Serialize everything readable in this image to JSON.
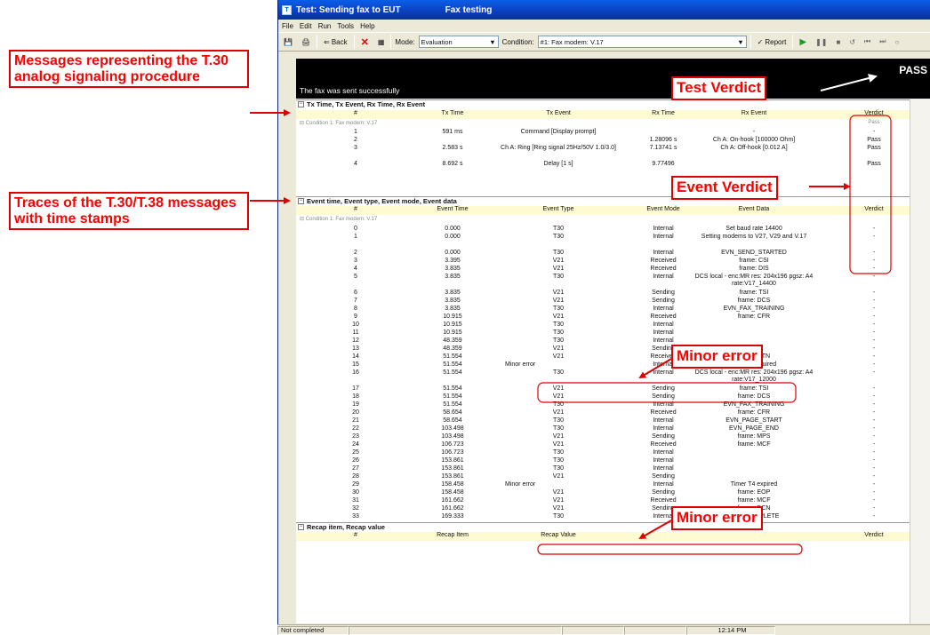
{
  "window": {
    "title": "Test: Sending fax to EUT",
    "subtitle": "Fax testing"
  },
  "menu": [
    "File",
    "Edit",
    "Run",
    "Tools",
    "Help"
  ],
  "toolbar": {
    "back_label": "Back",
    "mode_label": "Mode:",
    "mode_value": "Evaluation",
    "condition_label": "Condition:",
    "condition_value": "#1: Fax modem: V.17",
    "report_label": "Report"
  },
  "banner": {
    "verdict": "PASS",
    "message": "The fax was sent successfully"
  },
  "section1": {
    "title": "Tx Time, Tx Event, Rx Time, Rx Event",
    "headers": [
      "#",
      "Tx Time",
      "Tx Event",
      "Rx Time",
      "Rx Event",
      "Verdict"
    ],
    "condition": "Condition 1: Fax modem: V.17",
    "condition_verdict": "Pass",
    "rows": [
      {
        "n": "1",
        "txt": "591 ms",
        "txe": "Command [Display prompt]",
        "rxt": "",
        "rxe": "-",
        "v": "-"
      },
      {
        "n": "2",
        "txt": "",
        "txe": "",
        "rxt": "1.28096 s",
        "rxe": "Ch A: On-hook [100000 Ohm]",
        "v": "Pass"
      },
      {
        "n": "3",
        "txt": "2.583 s",
        "txe": "Ch A: Ring [Ring signal 25Hz/50V 1.0/3.0]",
        "rxt": "7.13741 s",
        "rxe": "Ch A: Off-hook [0.012 A]",
        "v": "Pass"
      },
      {
        "n": "4",
        "txt": "8.692 s",
        "txe": "Delay [1 s]",
        "rxt": "9.77496",
        "rxe": "",
        "v": "Pass"
      }
    ]
  },
  "section2": {
    "title": "Event time, Event type, Event mode, Event data",
    "headers": [
      "#",
      "Event Time",
      "Event Type",
      "Event Mode",
      "Event Data",
      "Verdict"
    ],
    "condition": "Condition 1: Fax modem: V.17",
    "rows": [
      {
        "n": "0",
        "t": "0.000",
        "ty": "T30",
        "m": "Internal",
        "d": "Set baud rate 14400",
        "v": "-"
      },
      {
        "n": "1",
        "t": "0.000",
        "ty": "T30",
        "m": "Internal",
        "d": "Setting modems to V27, V29 and V.17",
        "v": "-"
      },
      {
        "n": "2",
        "t": "0.000",
        "ty": "T30",
        "m": "Internal",
        "d": "EVN_SEND_STARTED",
        "v": "-"
      },
      {
        "n": "3",
        "t": "3.395",
        "ty": "V21",
        "m": "Received",
        "d": "frame: CSI",
        "v": "-"
      },
      {
        "n": "4",
        "t": "3.835",
        "ty": "V21",
        "m": "Received",
        "d": "frame: DIS",
        "v": "-"
      },
      {
        "n": "5",
        "t": "3.835",
        "ty": "T30",
        "m": "Internal",
        "d": "DCS local - enc:MR res: 204x196 pgsz: A4 rate:V17_14400",
        "v": "-"
      },
      {
        "n": "6",
        "t": "3.835",
        "ty": "V21",
        "m": "Sending",
        "d": "frame: TSI",
        "v": "-"
      },
      {
        "n": "7",
        "t": "3.835",
        "ty": "V21",
        "m": "Sending",
        "d": "frame: DCS",
        "v": "-"
      },
      {
        "n": "8",
        "t": "3.835",
        "ty": "T30",
        "m": "Internal",
        "d": "EVN_FAX_TRAINING",
        "v": "-"
      },
      {
        "n": "9",
        "t": "10.915",
        "ty": "V21",
        "m": "Received",
        "d": "frame: CFR",
        "v": "-"
      },
      {
        "n": "10",
        "t": "10.915",
        "ty": "T30",
        "m": "Internal",
        "d": "",
        "v": "-"
      },
      {
        "n": "11",
        "t": "10.915",
        "ty": "T30",
        "m": "Internal",
        "d": "",
        "v": "-"
      },
      {
        "n": "12",
        "t": "48.359",
        "ty": "T30",
        "m": "Internal",
        "d": "",
        "v": "-"
      },
      {
        "n": "13",
        "t": "48.359",
        "ty": "V21",
        "m": "Sending",
        "d": "",
        "v": "-"
      },
      {
        "n": "14",
        "t": "51.554",
        "ty": "V21",
        "m": "Received",
        "d": "frame: RTN",
        "v": "-"
      },
      {
        "n": "15",
        "t": "51.554",
        "ty": "Minor error",
        "m": "Internal",
        "d": "Retrain required",
        "v": "-"
      },
      {
        "n": "16",
        "t": "51.554",
        "ty": "T30",
        "m": "Internal",
        "d": "DCS local - enc:MR res: 204x196 pgsz: A4 rate:V17_12000",
        "v": "-"
      },
      {
        "n": "17",
        "t": "51.554",
        "ty": "V21",
        "m": "Sending",
        "d": "frame: TSI",
        "v": "-"
      },
      {
        "n": "18",
        "t": "51.554",
        "ty": "V21",
        "m": "Sending",
        "d": "frame: DCS",
        "v": "-"
      },
      {
        "n": "19",
        "t": "51.554",
        "ty": "T30",
        "m": "Internal",
        "d": "EVN_FAX_TRAINING",
        "v": "-"
      },
      {
        "n": "20",
        "t": "58.654",
        "ty": "V21",
        "m": "Received",
        "d": "frame: CFR",
        "v": "-"
      },
      {
        "n": "21",
        "t": "58.654",
        "ty": "T30",
        "m": "Internal",
        "d": "EVN_PAGE_START",
        "v": "-"
      },
      {
        "n": "22",
        "t": "103.498",
        "ty": "T30",
        "m": "Internal",
        "d": "EVN_PAGE_END",
        "v": "-"
      },
      {
        "n": "23",
        "t": "103.498",
        "ty": "V21",
        "m": "Sending",
        "d": "frame: MPS",
        "v": "-"
      },
      {
        "n": "24",
        "t": "106.723",
        "ty": "V21",
        "m": "Received",
        "d": "frame: MCF",
        "v": "-"
      },
      {
        "n": "25",
        "t": "106.723",
        "ty": "T30",
        "m": "Internal",
        "d": "",
        "v": "-"
      },
      {
        "n": "26",
        "t": "153.861",
        "ty": "T30",
        "m": "Internal",
        "d": "",
        "v": "-"
      },
      {
        "n": "27",
        "t": "153.861",
        "ty": "T30",
        "m": "Internal",
        "d": "",
        "v": "-"
      },
      {
        "n": "28",
        "t": "153.861",
        "ty": "V21",
        "m": "Sending",
        "d": "",
        "v": "-"
      },
      {
        "n": "29",
        "t": "158.458",
        "ty": "Minor error",
        "m": "Internal",
        "d": "Timer T4 expired",
        "v": "-"
      },
      {
        "n": "30",
        "t": "158.458",
        "ty": "V21",
        "m": "Sending",
        "d": "frame: EOP",
        "v": "-"
      },
      {
        "n": "31",
        "t": "161.662",
        "ty": "V21",
        "m": "Received",
        "d": "frame: MCF",
        "v": "-"
      },
      {
        "n": "32",
        "t": "161.662",
        "ty": "V21",
        "m": "Sending",
        "d": "frame: DCN",
        "v": "-"
      },
      {
        "n": "33",
        "t": "169.333",
        "ty": "T30",
        "m": "Internal",
        "d": "EVN_COMPLETE",
        "v": "-"
      }
    ]
  },
  "section3": {
    "title": "Recap item, Recap value",
    "headers": [
      "#",
      "Recap Item",
      "Recap Value",
      "Verdict"
    ]
  },
  "status": {
    "text": "Not completed",
    "time": "12:14 PM"
  },
  "annotations": {
    "t30_analog": "Messages representing the T.30 analog signaling procedure",
    "t30_t38": "Traces of the T.30/T.38 messages with time stamps",
    "test_verdict": "Test Verdict",
    "event_verdict": "Event Verdict",
    "minor_error_1": "Minor error",
    "minor_error_2": "Minor error"
  },
  "colors": {
    "callout": "#ff0000",
    "title_bar": "#0a3fbf",
    "header_fill": "#fefbd2",
    "banner": "#000000"
  }
}
